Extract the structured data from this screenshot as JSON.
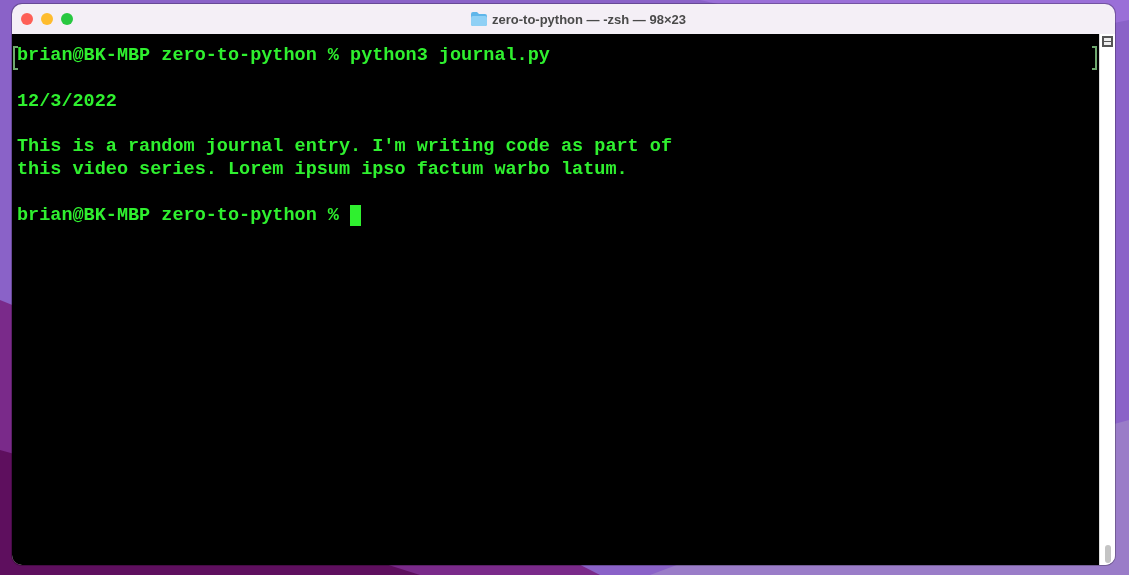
{
  "window": {
    "title": "zero-to-python — -zsh — 98×23"
  },
  "terminal": {
    "blocks": [
      {
        "lines": [
          "brian@BK-MBP zero-to-python % python3 journal.py"
        ],
        "marked": true
      },
      {
        "lines": [
          "12/3/2022"
        ]
      },
      {
        "lines": [
          "This is a random journal entry. I'm writing code as part of",
          "this video series. Lorem ipsum ipso factum warbo latum."
        ]
      },
      {
        "lines": [
          "brian@BK-MBP zero-to-python % "
        ],
        "cursor": true
      }
    ]
  }
}
